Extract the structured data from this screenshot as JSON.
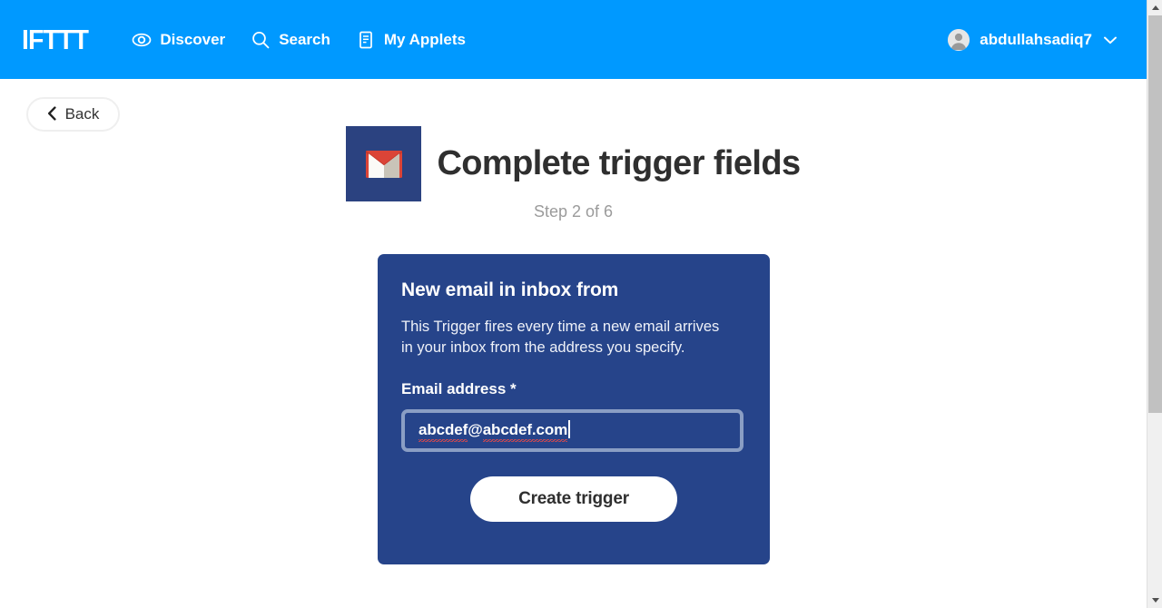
{
  "header": {
    "brand": "IFTTT",
    "nav": [
      {
        "label": "Discover",
        "icon": "eye-icon"
      },
      {
        "label": "Search",
        "icon": "search-icon"
      },
      {
        "label": "My Applets",
        "icon": "document-icon"
      }
    ],
    "account": {
      "username": "abdullahsadiq7",
      "chevron": "⌄",
      "avatar_icon": "user-avatar-icon"
    },
    "background_color": "#0099FF"
  },
  "back_button": {
    "label": "Back",
    "chevron": "❮"
  },
  "page": {
    "title": "Complete trigger fields",
    "step": "Step 2 of 6",
    "service_icon": "gmail-icon",
    "service_icon_bg": "#2B4280"
  },
  "card": {
    "background_color": "#26448A",
    "title": "New email in inbox from",
    "description": "This Trigger fires every time a new email arrives in your inbox from the address you specify.",
    "field": {
      "label": "Email address *",
      "value": "abcdef@abcdef.com",
      "value_part1": "abcdef",
      "value_at": "@",
      "value_part2": "abcdef.com",
      "placeholder": "Email address",
      "border_color": "#8a9ec4"
    },
    "submit_button": {
      "label": "Create trigger"
    }
  },
  "scrollbar": {
    "up_arrow": "scroll-up-arrow",
    "down_arrow": "scroll-down-arrow",
    "thumb": "scroll-thumb"
  }
}
